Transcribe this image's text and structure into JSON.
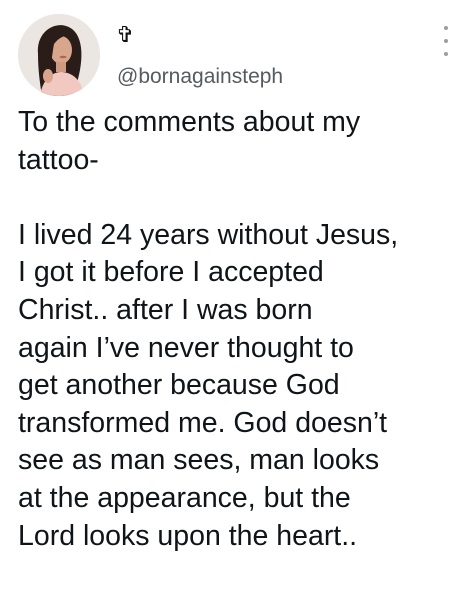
{
  "author": {
    "display_name": "✞",
    "handle": "@bornagainsteph",
    "avatar_icon": "profile-photo"
  },
  "menu": {
    "icon": "more-vertical-icon"
  },
  "tweet": {
    "text": "To the comments about my\ntattoo-\n\nI lived 24 years without Jesus,\nI got it before I accepted\nChrist.. after I was born\nagain I’ve never thought to\nget another because God\ntransformed me. God doesn’t\nsee as man sees, man looks\nat the appearance, but the\nLord looks upon the heart.."
  },
  "colors": {
    "text": "#0f1419",
    "handle": "#555b61",
    "menu_dots": "#9a9fa5"
  }
}
